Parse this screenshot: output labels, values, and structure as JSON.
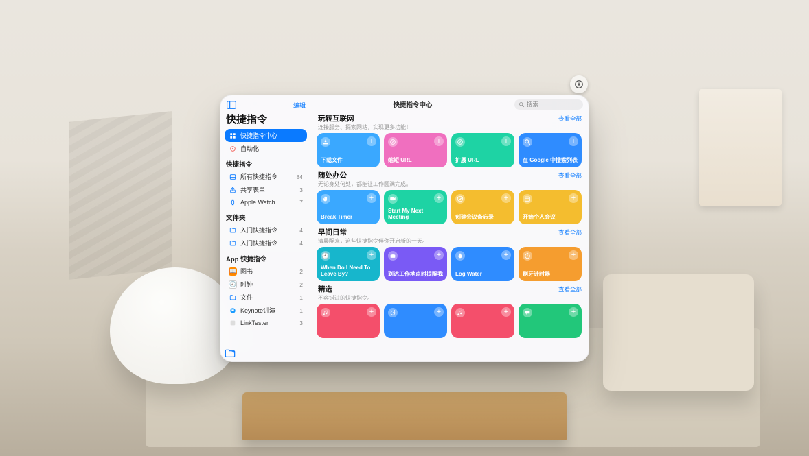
{
  "compass_icon": "compass",
  "sidebar": {
    "edit_label": "编辑",
    "app_title": "快捷指令",
    "primary": [
      {
        "icon": "grid",
        "label": "快捷指令中心",
        "selected": true
      },
      {
        "icon": "auto",
        "label": "自动化",
        "selected": false
      }
    ],
    "groups": [
      {
        "label": "快捷指令",
        "items": [
          {
            "icon": "tray",
            "color": "blue",
            "label": "所有快捷指令",
            "count": 84
          },
          {
            "icon": "share",
            "color": "blue",
            "label": "共享表单",
            "count": 3
          },
          {
            "icon": "watch",
            "color": "blue",
            "label": "Apple Watch",
            "count": 7
          }
        ]
      },
      {
        "label": "文件夹",
        "items": [
          {
            "icon": "folder",
            "color": "blue",
            "label": "入门快捷指令",
            "count": 4
          },
          {
            "icon": "folder",
            "color": "blue",
            "label": "入门快捷指令",
            "count": 4
          }
        ]
      },
      {
        "label": "App 快捷指令",
        "items": [
          {
            "icon": "book",
            "color": "orange-sq",
            "label": "图书",
            "count": 2
          },
          {
            "icon": "clock",
            "color": "white-sq",
            "label": "时钟",
            "count": 2
          },
          {
            "icon": "folder",
            "color": "blue",
            "label": "文件",
            "count": 1
          },
          {
            "icon": "keynote",
            "color": "blue",
            "label": "Keynote讲演",
            "count": 1
          },
          {
            "icon": "link",
            "color": "grey",
            "label": "LinkTester",
            "count": 3
          }
        ]
      }
    ]
  },
  "topbar": {
    "title": "快捷指令中心",
    "search_placeholder": "搜索"
  },
  "sections": [
    {
      "title": "玩转互联网",
      "subtitle": "连接服务、探索网站，实现更多功能！",
      "see_all": "查看全部",
      "cards": [
        {
          "icon": "download",
          "label": "下载文件",
          "color": "#3aa8ff"
        },
        {
          "icon": "compass",
          "label": "缩短 URL",
          "color": "#f06fbf"
        },
        {
          "icon": "compass",
          "label": "扩展 URL",
          "color": "#1ed3a4"
        },
        {
          "icon": "search",
          "label": "在 Google 中搜索列表",
          "color": "#2f8cff"
        }
      ]
    },
    {
      "title": "随处办公",
      "subtitle": "无论身处何处，都能让工作圆满完成。",
      "see_all": "查看全部",
      "cards": [
        {
          "icon": "hand",
          "label": "Break Timer",
          "color": "#3aa8ff"
        },
        {
          "icon": "camera",
          "label": "Start My Next Meeting",
          "color": "#1ed3a4"
        },
        {
          "icon": "check",
          "label": "创建会议备忘录",
          "color": "#f4bd2f"
        },
        {
          "icon": "cal",
          "label": "开始个人会议",
          "color": "#f4bd2f"
        }
      ]
    },
    {
      "title": "早间日常",
      "subtitle": "清晨醒来，这些快捷指令伴你开启新的一天。",
      "see_all": "查看全部",
      "cards": [
        {
          "icon": "clock",
          "label": "When Do I Need To Leave By?",
          "color": "#17b6cc"
        },
        {
          "icon": "brief",
          "label": "到达工作地点时提醒我",
          "color": "#7a5af5"
        },
        {
          "icon": "drop",
          "label": "Log Water",
          "color": "#2f8cff"
        },
        {
          "icon": "timer",
          "label": "刷牙计时器",
          "color": "#f59d2f"
        }
      ]
    },
    {
      "title": "精选",
      "subtitle": "不容错过的快捷指令。",
      "see_all": "查看全部",
      "cards": [
        {
          "icon": "music",
          "label": "",
          "color": "#f44f6b"
        },
        {
          "icon": "alarm",
          "label": "",
          "color": "#2f8cff"
        },
        {
          "icon": "music",
          "label": "",
          "color": "#f44f6b"
        },
        {
          "icon": "chat",
          "label": "",
          "color": "#22c77a"
        }
      ]
    }
  ]
}
